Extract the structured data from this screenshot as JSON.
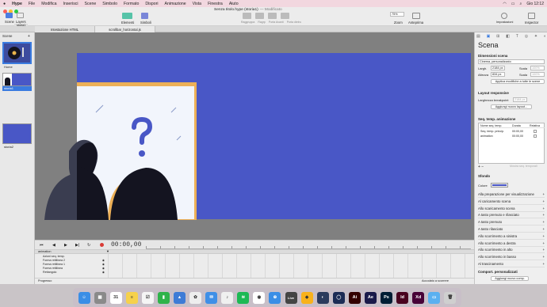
{
  "menubar": {
    "apple": "",
    "items": [
      "Hype",
      "File",
      "Modifica",
      "Inserisci",
      "Scene",
      "Simbolo",
      "Formato",
      "Dispori",
      "Animazione",
      "Vista",
      "Finestra",
      "Aiuto"
    ],
    "clock": "Gio 12:12"
  },
  "window": {
    "title": "Senza titolo.hype (storia1)",
    "subtitle": "— Modificato"
  },
  "toolbar": {
    "scene_label": "Scene",
    "layers_label": "Layers",
    "elements_label": "Elementi",
    "symbols_label": "Simboli",
    "align_labels": [
      "Raggruppa",
      "Ragrp",
      "Porta Avanti",
      "Porta dietro"
    ],
    "zoom_value": "75%",
    "zoom_label": "Zoom",
    "preview_label": "Anteprima",
    "settings_label": "Impostazioni",
    "inspector_label": "Inspector",
    "scene_badge": "storia1"
  },
  "doc_tabs": [
    "Intestazione HTML",
    "scrollbar_horizontal.js"
  ],
  "scene_list": {
    "header": "Scene",
    "scenes": [
      {
        "name": "Home"
      },
      {
        "name": "storia1"
      },
      {
        "name": "storia2"
      }
    ]
  },
  "timeline": {
    "time": "00:00,00",
    "track_name": "animation",
    "header_row": "Azioni seq. temp.",
    "layers": [
      "Forma rettilinea 2",
      "Forma rettilinea 1",
      "Forma rettilinea",
      "Rettangolo"
    ],
    "bottom_label": "Progresso",
    "snap_label": "Accodato a scorrere"
  },
  "inspector": {
    "title": "Scena",
    "scene_size_header": "Dimensioni scena",
    "preset": "Cinema, personalizzato",
    "width_label": "Largh.",
    "width_value": "2184 px",
    "height_label": "Altezza",
    "height_value": "834 px",
    "scale_label": "Scala",
    "scale_value": "100%",
    "apply_label": "Applica modifiche a tutte le scene",
    "layout_header": "Layout responsive",
    "breakpoint_label": "Larghezza breakpoint",
    "breakpoint_value": "2184 px",
    "add_layout_btn": "Aggiungi nuovo layout...",
    "timelines_header": "Seq. temp. animazione",
    "tl_col_name": "Nome seq. temp.",
    "tl_col_duration": "Durata",
    "tl_col_relative": "Relativa",
    "timelines": [
      {
        "name": "Seq. temp. princip.",
        "duration": "00:00,00"
      },
      {
        "name": "animation",
        "duration": "00:00,00"
      }
    ],
    "tl_footer": "Mostra seq. temporali",
    "bg_header": "Sfondo",
    "color_label": "Colore",
    "bg_color": "#4957c6",
    "actions": [
      "Alla preparazione per visualizzazione",
      "Al caricamento scena",
      "Allo scaricamento scena",
      "A tasto premuto e rilasciato",
      "A tasto premuto",
      "A tasto rilasciato",
      "Allo scorrimento a sinistra",
      "Allo scorrimento a destra",
      "Allo scorrimento in alto",
      "Allo scorrimento in basso",
      "Al trascinamento"
    ],
    "custom_header": "Comport. personalizzati",
    "add_behavior_btn": "Aggiungi nuovo comp."
  },
  "dock": {
    "apps": [
      {
        "name": "Finder",
        "color": "#3a8ee6",
        "glyph": "☺"
      },
      {
        "name": "Launchpad",
        "color": "#8a8a8a",
        "glyph": "▦"
      },
      {
        "name": "Calendar",
        "color": "#ffffff",
        "glyph": "31"
      },
      {
        "name": "Notes",
        "color": "#f6d14b",
        "glyph": "≡"
      },
      {
        "name": "Reminders",
        "color": "#f5f5f5",
        "glyph": "☑"
      },
      {
        "name": "Numbers",
        "color": "#2fb34a",
        "glyph": "▮"
      },
      {
        "name": "Keynote",
        "color": "#3e7bd6",
        "glyph": "▲"
      },
      {
        "name": "Photos",
        "color": "#eeeeee",
        "glyph": "✿"
      },
      {
        "name": "Mail",
        "color": "#3f8fe7",
        "glyph": "✉"
      },
      {
        "name": "Music",
        "color": "#f0f0f0",
        "glyph": "♪"
      },
      {
        "name": "Spotify",
        "color": "#1db954",
        "glyph": "≋"
      },
      {
        "name": "Chrome",
        "color": "#ffffff",
        "glyph": "◉"
      },
      {
        "name": "Safari",
        "color": "#3a8ee6",
        "glyph": "⊕"
      },
      {
        "name": "Live",
        "color": "#444444",
        "glyph": "Live"
      },
      {
        "name": "Sketch",
        "color": "#f8b21c",
        "glyph": "◆"
      },
      {
        "name": "Lightroom",
        "color": "#2b3b5d",
        "glyph": "◐"
      },
      {
        "name": "Cinema4D",
        "color": "#1c2c55",
        "glyph": "◯"
      },
      {
        "name": "Illustrator",
        "color": "#330000",
        "glyph": "Ai"
      },
      {
        "name": "After Effects",
        "color": "#1a1a4a",
        "glyph": "Ae"
      },
      {
        "name": "Photoshop",
        "color": "#001d34",
        "glyph": "Ps"
      },
      {
        "name": "InDesign",
        "color": "#49021f",
        "glyph": "Id"
      },
      {
        "name": "XD",
        "color": "#470137",
        "glyph": "Xd"
      },
      {
        "name": "Folder",
        "color": "#5ab0f0",
        "glyph": "▭"
      },
      {
        "name": "Trash",
        "color": "#cfcfcf",
        "glyph": "🗑"
      }
    ]
  }
}
